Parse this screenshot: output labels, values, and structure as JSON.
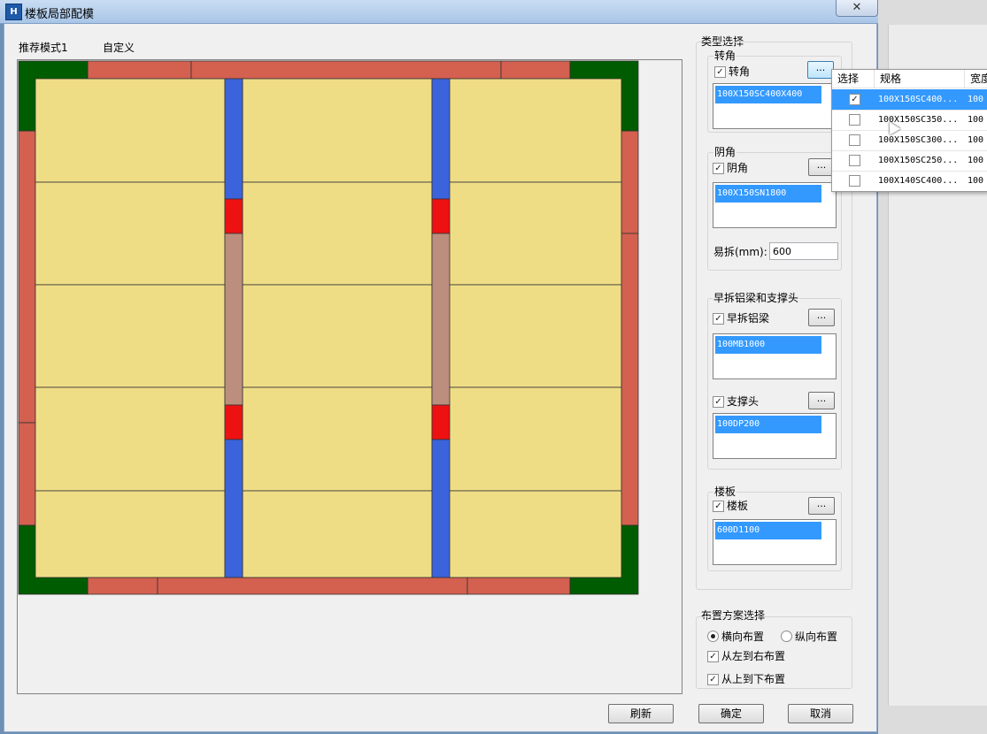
{
  "window": {
    "title": "楼板局部配模",
    "close_label": "✕"
  },
  "mode": {
    "recommended_label": "推荐模式1",
    "custom_label": "自定义"
  },
  "type_select": {
    "group_label": "类型选择",
    "corner": {
      "group_label": "转角",
      "check_label": "转角",
      "checked": true,
      "more_label": "...",
      "selected_item": "100X150SC400X400"
    },
    "inner_corner": {
      "group_label": "阴角",
      "check_label": "阴角",
      "checked": true,
      "more_label": "...",
      "selected_item": "100X150SN1800"
    },
    "easy_remove": {
      "label": "易拆(mm):",
      "value": "600"
    },
    "early_beam": {
      "group_label": "早拆铝梁和支撑头",
      "beam_check_label": "早拆铝梁",
      "beam_checked": true,
      "beam_more_label": "...",
      "beam_item": "100MB1000",
      "head_check_label": "支撑头",
      "head_checked": true,
      "head_more_label": "...",
      "head_item": "100DP200"
    },
    "floor": {
      "group_label": "楼板",
      "check_label": "楼板",
      "checked": true,
      "more_label": "...",
      "selected_item": "600D1100"
    }
  },
  "layout_select": {
    "group_label": "布置方案选择",
    "radio_horizontal": "横向布置",
    "radio_vertical": "纵向布置",
    "selected": "横向布置",
    "left_to_right": "从左到右布置",
    "top_to_bottom": "从上到下布置"
  },
  "buttons": {
    "refresh": "刷新",
    "ok": "确定",
    "cancel": "取消"
  },
  "popup": {
    "headers": {
      "select": "选择",
      "spec": "规格",
      "width": "宽度"
    },
    "rows": [
      {
        "checked": "✓",
        "spec": "100X150SC400...",
        "width": "100"
      },
      {
        "checked": "",
        "spec": "100X150SC350...",
        "width": "100"
      },
      {
        "checked": "",
        "spec": "100X150SC300...",
        "width": "100"
      },
      {
        "checked": "",
        "spec": "100X150SC250...",
        "width": "100"
      },
      {
        "checked": "",
        "spec": "100X140SC400...",
        "width": "100"
      }
    ]
  },
  "colors": {
    "corner": "#005c00",
    "edge": "#d46050",
    "panel": "#efdd86",
    "beam": "#3b64dc",
    "support": "#ee1111",
    "beam_mid": "#bb8e7e"
  }
}
